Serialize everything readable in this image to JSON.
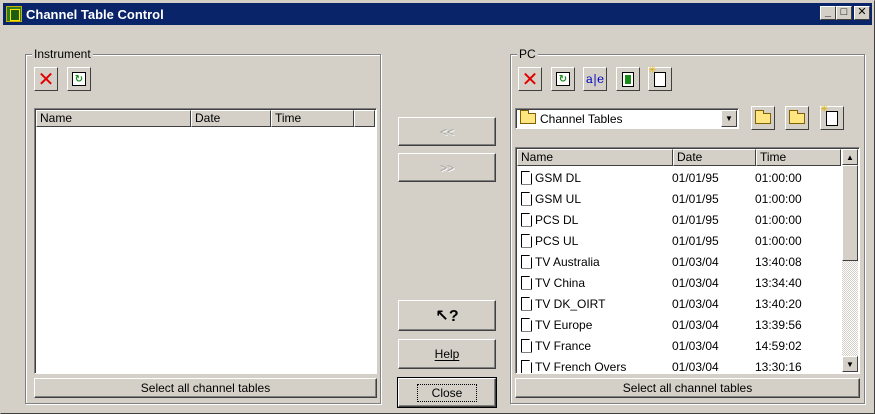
{
  "window": {
    "title": "Channel Table Control",
    "controls": [
      "_",
      "□",
      "✕"
    ]
  },
  "instrument": {
    "group_label": "Instrument",
    "columns": [
      "Name",
      "Date",
      "Time"
    ],
    "rows": [],
    "select_all_label": "Select all channel tables"
  },
  "middle": {
    "copy_to_instrument": "<<",
    "copy_to_pc": ">>",
    "help_pointer_icon": "help-pointer-icon",
    "help_pointer_glyph": "?",
    "help_label": "Help",
    "close_label": "Close"
  },
  "pc": {
    "group_label": "PC",
    "folder_selected": "Channel Tables",
    "columns": [
      "Name",
      "Date",
      "Time"
    ],
    "rows": [
      {
        "name": "GSM DL",
        "date": "01/01/95",
        "time": "01:00:00"
      },
      {
        "name": "GSM UL",
        "date": "01/01/95",
        "time": "01:00:00"
      },
      {
        "name": "PCS DL",
        "date": "01/01/95",
        "time": "01:00:00"
      },
      {
        "name": "PCS UL",
        "date": "01/01/95",
        "time": "01:00:00"
      },
      {
        "name": "TV Australia",
        "date": "01/03/04",
        "time": "13:40:08"
      },
      {
        "name": "TV China",
        "date": "01/03/04",
        "time": "13:34:40"
      },
      {
        "name": "TV DK_OIRT",
        "date": "01/03/04",
        "time": "13:40:20"
      },
      {
        "name": "TV Europe",
        "date": "01/03/04",
        "time": "13:39:56"
      },
      {
        "name": "TV France",
        "date": "01/03/04",
        "time": "14:59:02"
      },
      {
        "name": "TV French Overs",
        "date": "01/03/04",
        "time": "13:30:16"
      }
    ],
    "select_all_label": "Select all channel tables"
  },
  "colors": {
    "titlebar": "#0a246a",
    "face": "#d4d0c8",
    "delete_red": "#e00000",
    "refresh_green": "#1a8a1a"
  }
}
